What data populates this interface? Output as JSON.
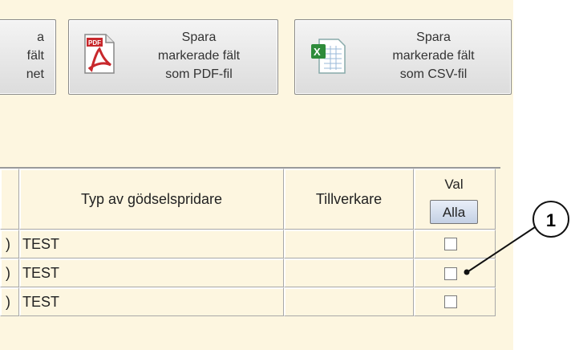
{
  "toolbar": {
    "partial_button_lines": [
      "a",
      "fält",
      "net"
    ],
    "pdf_button_lines": [
      "Spara",
      "markerade fält",
      "som PDF-fil"
    ],
    "csv_button_lines": [
      "Spara",
      "markerade fält",
      "som CSV-fil"
    ],
    "pdf_icon": "pdf-file-icon",
    "csv_icon": "excel-csv-file-icon"
  },
  "table": {
    "headers": {
      "type": "Typ av gödselspridare",
      "manufacturer": "Tillverkare",
      "select": "Val",
      "select_all_button": "Alla"
    },
    "rows": [
      {
        "prefix": ")",
        "type": "TEST",
        "manufacturer": "",
        "checked": false
      },
      {
        "prefix": ")",
        "type": "TEST",
        "manufacturer": "",
        "checked": false
      },
      {
        "prefix": ")",
        "type": "TEST",
        "manufacturer": "",
        "checked": false
      }
    ]
  },
  "callout": {
    "label": "1"
  }
}
